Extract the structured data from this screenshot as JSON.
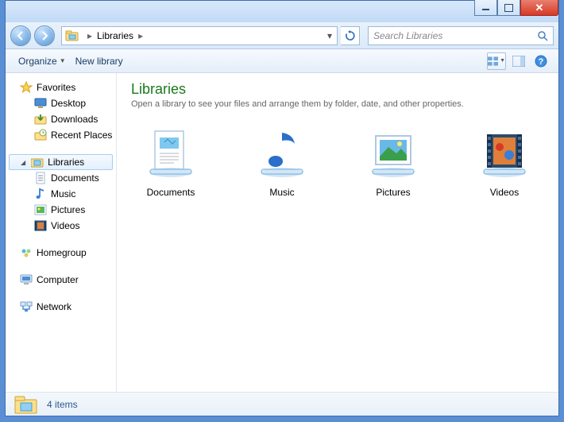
{
  "breadcrumb": {
    "root": "Libraries"
  },
  "search": {
    "placeholder": "Search Libraries"
  },
  "toolbar": {
    "organize": "Organize",
    "newlibrary": "New library"
  },
  "sidebar": {
    "favorites": {
      "label": "Favorites",
      "items": [
        "Desktop",
        "Downloads",
        "Recent Places"
      ]
    },
    "libraries": {
      "label": "Libraries",
      "items": [
        "Documents",
        "Music",
        "Pictures",
        "Videos"
      ]
    },
    "homegroup": "Homegroup",
    "computer": "Computer",
    "network": "Network"
  },
  "main": {
    "title": "Libraries",
    "subtitle": "Open a library to see your files and arrange them by folder, date, and other properties.",
    "items": [
      "Documents",
      "Music",
      "Pictures",
      "Videos"
    ]
  },
  "status": {
    "count": "4 items"
  }
}
